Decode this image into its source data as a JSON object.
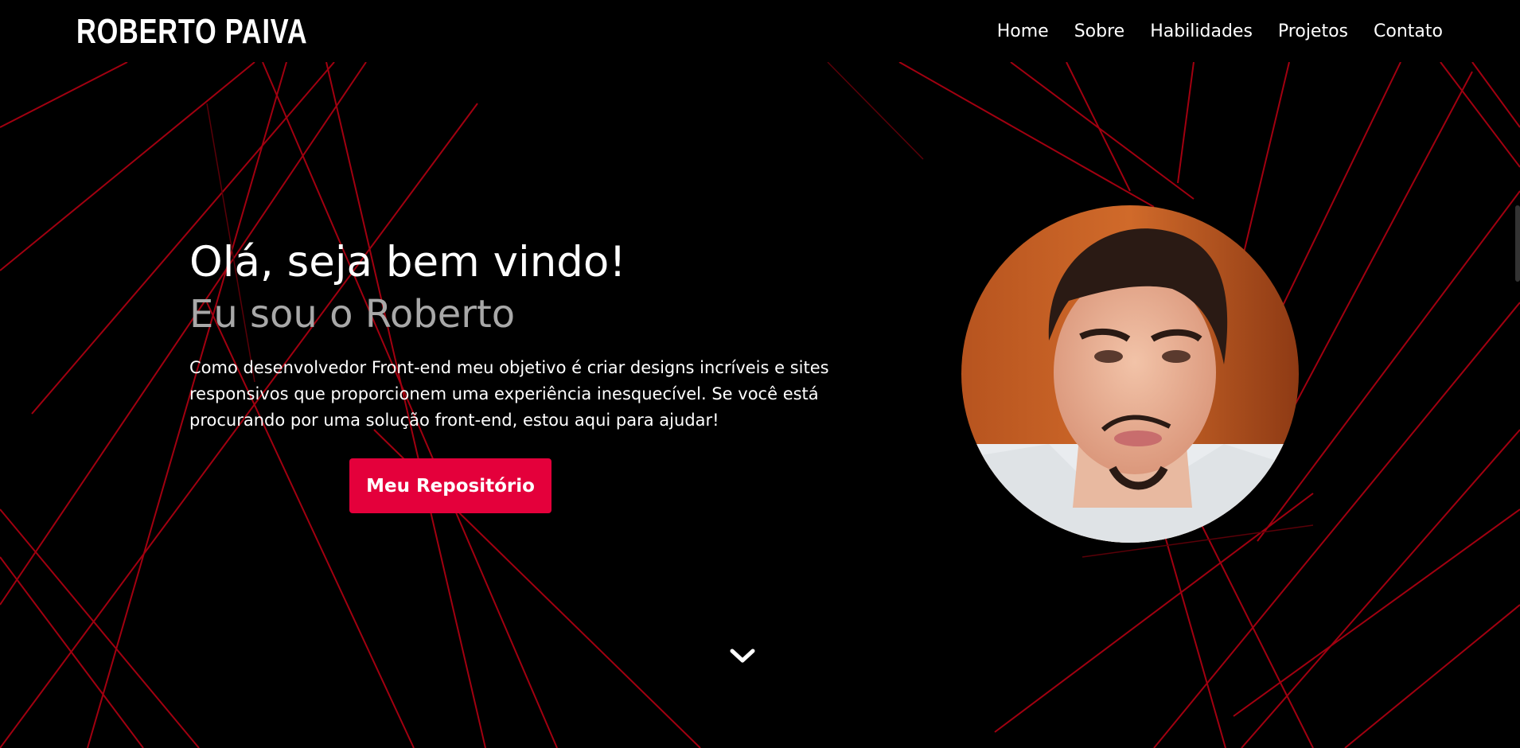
{
  "header": {
    "logo": "ROBERTO PAIVA",
    "nav": [
      "Home",
      "Sobre",
      "Habilidades",
      "Projetos",
      "Contato"
    ]
  },
  "hero": {
    "greeting": "Olá, seja bem vindo!",
    "subgreeting": "Eu sou o Roberto",
    "description": "Como desenvolvedor Front-end meu objetivo é criar designs incríveis e sites responsivos que proporcionem uma experiência inesquecível. Se você está procurando por uma solução front-end, estou aqui para ajudar!",
    "cta_label": "Meu Repositório"
  },
  "icons": {
    "scroll_down": "chevron-down-icon"
  },
  "colors": {
    "background": "#000000",
    "accent": "#e4003b",
    "lines": "#b30012",
    "subtitle": "#a8a8a8"
  }
}
